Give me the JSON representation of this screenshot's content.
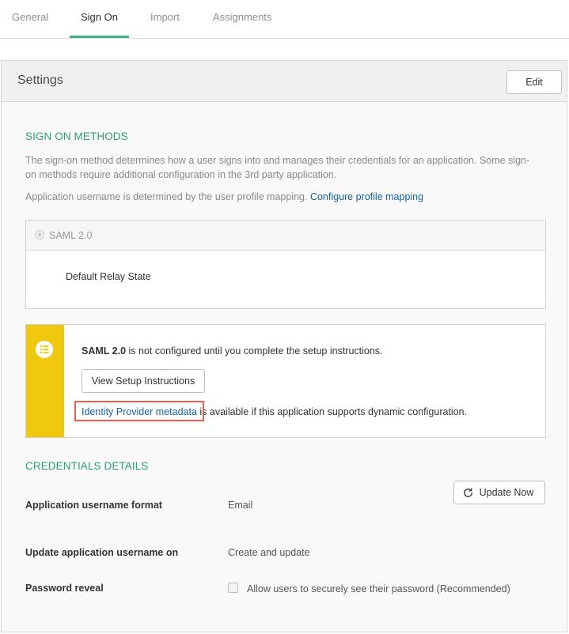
{
  "tabs": [
    "General",
    "Sign On",
    "Import",
    "Assignments"
  ],
  "active_tab": "Sign On",
  "settings": {
    "title": "Settings",
    "edit_label": "Edit"
  },
  "sign_on_methods": {
    "title": "SIGN ON METHODS",
    "description_line1": "The sign-on method determines how a user signs into and manages their credentials for an application. Some sign-",
    "description_line2": "on methods require additional configuration in the 3rd party application.",
    "username_text": "Application username is determined by the user profile mapping.",
    "configure_link": "Configure profile mapping",
    "saml_label": "SAML 2.0",
    "relay_state_label": "Default Relay State"
  },
  "notice": {
    "saml_bold": "SAML 2.0",
    "message": " is not configured until you complete the setup instructions.",
    "setup_button": "View Setup Instructions",
    "metadata_link": "Identity Provider metadata",
    "metadata_suffix": " is available if this application supports dynamic configuration.",
    "bar_color": "#f0c90e",
    "icon": "list-icon"
  },
  "credentials": {
    "title": "CREDENTIALS DETAILS",
    "format_label": "Application username format",
    "format_value": "Email",
    "update_label": "Update application username on",
    "update_value": "Create and update",
    "update_button": "Update Now",
    "password_label": "Password reveal",
    "password_option": "Allow users to securely see their password (Recommended)"
  },
  "colors": {
    "accent": "#43b08b",
    "link": "#1662a0",
    "highlight": "#ee5f4b"
  }
}
